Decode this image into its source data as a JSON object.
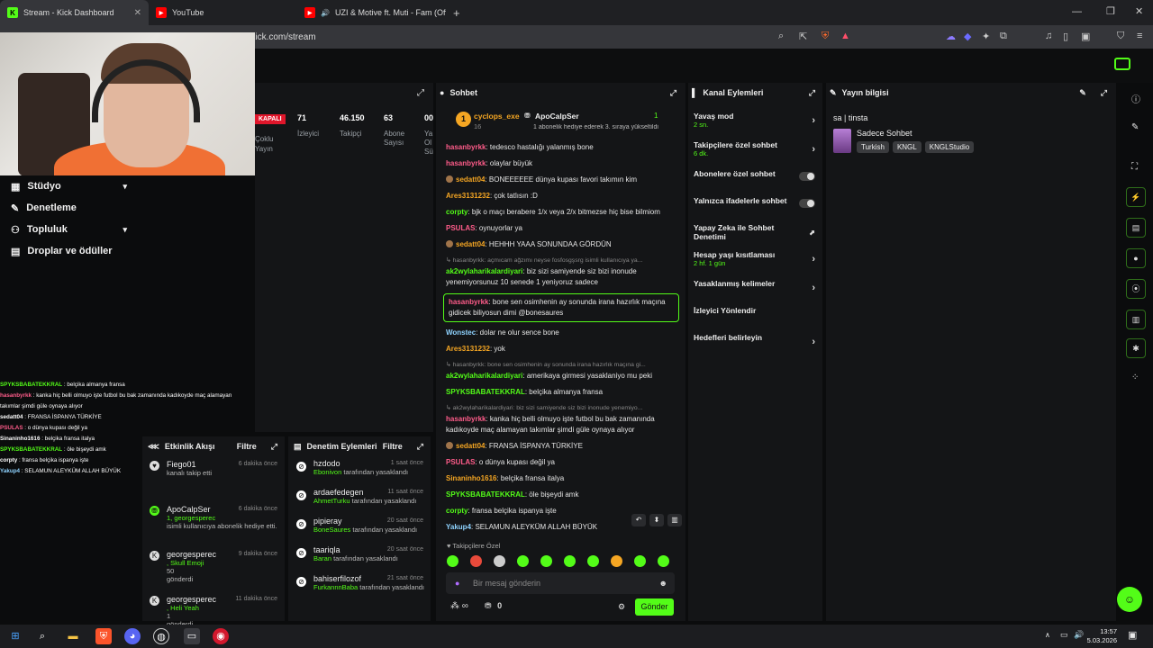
{
  "browser": {
    "tabs": [
      {
        "title": "Stream - Kick Dashboard",
        "active": true
      },
      {
        "title": "YouTube",
        "active": false
      },
      {
        "title": "UZI & Motive ft. Muti - Fam (Offi",
        "active": false
      }
    ],
    "new_tab": "+",
    "url": "board.kick.com/stream"
  },
  "sidenav": {
    "items": [
      {
        "label": "Stüdyo",
        "chev": true
      },
      {
        "label": "Denetleme",
        "chev": false
      },
      {
        "label": "Topluluk",
        "chev": true
      },
      {
        "label": "Droplar ve ödüller",
        "chev": false
      }
    ]
  },
  "overlay_chat": [
    {
      "user": "SPYKSBABATEKKRAL",
      "text": " : belçika almanya fransa",
      "color": "#53fc18"
    },
    {
      "user": "hasanbyrkk",
      "text": " : kanka hiç belli olmuyo işte futbol bu bak zamanında kadıkoyde maç alamayan",
      "color": "#ff5c8a"
    },
    {
      "user": "",
      "text": "takımlar şimdi güle oynaya alıyor",
      "color": "#fff"
    },
    {
      "user": "sedatt04",
      "text": " : FRANSA İSPANYA TÜRKİYE",
      "color": "#fff"
    },
    {
      "user": "PSULAS",
      "text": " : o dünya kupası değil ya",
      "color": "#ff5c8a"
    },
    {
      "user": "Sinaninho1616",
      "text": " : belçika fransa italya",
      "color": "#fff"
    },
    {
      "user": "SPYKSBABATEKKRAL",
      "text": " : öle bişeydi amk",
      "color": "#53fc18"
    },
    {
      "user": "corpty",
      "text": " : fransa belçika ispanya işte",
      "color": "#fff"
    },
    {
      "user": "Yakup4",
      "text": " : SELAMUN ALEYKÜM ALLAH BÜYÜK",
      "color": "#8fd3ff"
    }
  ],
  "stats": {
    "live": "KAPALI",
    "items": [
      {
        "value": "71",
        "label": "İzleyici"
      },
      {
        "value": "46.150",
        "label": "Takipçi"
      },
      {
        "value": "63",
        "label": "Abone Sayısı"
      },
      {
        "value": "00",
        "label": "Ya Ol Sü"
      }
    ],
    "left_label": "Çoklu Yayın"
  },
  "activity": {
    "title": "Etkinlik Akışı",
    "filter": "Filtre",
    "items": [
      {
        "name": "Fiego01",
        "time": "6 dakika önce",
        "line1": "kanalı takip etti",
        "line2": "",
        "line3": ""
      },
      {
        "name": "ApoCalpSer",
        "time": "6 dakika önce",
        "line1": "1, georgesperec",
        "line2": "isimli kullanıcıya abonelik hediye etti.",
        "line3": ""
      },
      {
        "name": "georgesperec",
        "time": "9 dakika önce",
        "line1": ", Skull Emoji",
        "line2": "50",
        "line3": "gönderdi"
      },
      {
        "name": "georgesperec",
        "time": "11 dakika önce",
        "line1": ", Heli Yeah",
        "line2": "1",
        "line3": "gönderdi"
      }
    ]
  },
  "moderation": {
    "title": "Denetim Eylemleri",
    "filter": "Filtre",
    "items": [
      {
        "name": "hzdodo",
        "time": "1 saat önce",
        "by": "Ebonivon",
        "action": " tarafından yasaklandı"
      },
      {
        "name": "ardaefedegen",
        "time": "11 saat önce",
        "by": "AhmetTurku",
        "action": " tarafından yasaklandı"
      },
      {
        "name": "pipieray",
        "time": "20 saat önce",
        "by": "BoneSaures",
        "action": " tarafından yasaklandı"
      },
      {
        "name": "taariqla",
        "time": "20 saat önce",
        "by": "Baran",
        "action": " tarafından yasaklandı"
      },
      {
        "name": "bahiserfilozof",
        "time": "21 saat önce",
        "by": "FurkannnBaba",
        "action": " tarafından yasaklandı"
      }
    ]
  },
  "chat": {
    "title": "Sohbet",
    "pinned_rank": "1",
    "pinned_user1": "cyclops_exe",
    "pinned_user1_count": "16",
    "pinned_user2": "ApoCalpSer",
    "pinned_count": "1",
    "pinned_text": "1 abonelik hediye ederek 3. sıraya yükseltildi",
    "messages": [
      {
        "user": "hasanbyrkk",
        "color": "#ff5c8a",
        "text": ": tedesco hastalığı yalanmış bone",
        "type": "normal",
        "badge": false
      },
      {
        "user": "hasanbyrkk",
        "color": "#ff5c8a",
        "text": ": olaylar büyük",
        "type": "normal",
        "badge": false
      },
      {
        "user": "sedatt04",
        "color": "#f5a623",
        "text": ": BONEEEEEE dünya kupası favori takımın kim",
        "type": "normal",
        "badge": true
      },
      {
        "user": "Ares3131232",
        "color": "#f5a623",
        "text": ": çok tatlısın :D",
        "type": "normal",
        "badge": false
      },
      {
        "user": "corpty",
        "color": "#53fc18",
        "text": ": bjk o maçı berabere 1/x veya 2/x bitmezse hiç bise bilmiom",
        "type": "normal",
        "badge": false
      },
      {
        "user": "PSULAS",
        "color": "#ff5c8a",
        "text": ": oynuyorlar ya",
        "type": "normal",
        "badge": false
      },
      {
        "user": "sedatt04",
        "color": "#f5a623",
        "text": ": HEHHH YAAA SONUNDAA GÖRDÜN",
        "type": "normal",
        "badge": true
      },
      {
        "user": "",
        "color": "#888",
        "text": "↳ hasanbyrkk: açmıcam ağzımı neyse fosfosgşsrg isimli kullanıcıya ya...",
        "type": "reply",
        "badge": false
      },
      {
        "user": "ak2wylaharikalardiyari",
        "color": "#53fc18",
        "text": ": biz sizi samiyende siz bizi inonude yenemiyorsunuz 10 senede 1 yeniyoruz sadece",
        "type": "normal",
        "badge": false
      },
      {
        "user": "hasanbyrkk",
        "color": "#ff5c8a",
        "text": ": bone sen osimhenin ay sonunda irana hazırlık maçına gidicek biliyosun dimi @bonesaures",
        "type": "highlight",
        "badge": false
      },
      {
        "user": "Wonstec",
        "color": "#8fd3ff",
        "text": ": dolar ne olur sence bone",
        "type": "normal",
        "badge": false
      },
      {
        "user": "Ares3131232",
        "color": "#f5a623",
        "text": ": yok",
        "type": "normal",
        "badge": false
      },
      {
        "user": "",
        "color": "#888",
        "text": "↳ hasanbyrkk: bone sen osimhenin ay sonunda irana hazırlık maçına gi...",
        "type": "reply",
        "badge": false
      },
      {
        "user": "ak2wylaharikalardiyari",
        "color": "#53fc18",
        "text": ": amerikaya girmesi yasaklaniyo mu peki",
        "type": "normal",
        "badge": false
      },
      {
        "user": "SPYKSBABATEKKRAL",
        "color": "#53fc18",
        "text": ": belçika almanya fransa",
        "type": "normal",
        "badge": false
      },
      {
        "user": "",
        "color": "#888",
        "text": "↳ ak2wylaharikalardiyari: biz sizi samiyende siz bizi inonude yenemiyo...",
        "type": "reply",
        "badge": false
      },
      {
        "user": "hasanbyrkk",
        "color": "#ff5c8a",
        "text": ": kanka hiç belli olmuyo işte futbol bu bak zamanında kadıkoyde maç alamayan takımlar şimdi güle oynaya alıyor",
        "type": "normal",
        "badge": false
      },
      {
        "user": "sedatt04",
        "color": "#f5a623",
        "text": ": FRANSA İSPANYA TÜRKİYE",
        "type": "normal",
        "badge": true
      },
      {
        "user": "PSULAS",
        "color": "#ff5c8a",
        "text": ": o dünya kupası değil ya",
        "type": "normal",
        "badge": false
      },
      {
        "user": "Sinaninho1616",
        "color": "#f5a623",
        "text": ": belçika fransa italya",
        "type": "normal",
        "badge": false
      },
      {
        "user": "SPYKSBABATEKKRAL",
        "color": "#53fc18",
        "text": ": öle bişeydi amk",
        "type": "normal",
        "badge": false
      },
      {
        "user": "corpty",
        "color": "#53fc18",
        "text": ": fransa belçika ispanya işte",
        "type": "normal",
        "badge": false
      },
      {
        "user": "Yakup4",
        "color": "#8fd3ff",
        "text": ": SELAMUN ALEYKÜM ALLAH BÜYÜK",
        "type": "normal",
        "badge": false
      }
    ],
    "subs_only_emotes": "Takipçilere Özel",
    "input_placeholder": "Bir mesaj gönderin",
    "points": "∞",
    "gift_count": "0",
    "send_label": "Gönder"
  },
  "channel_actions": {
    "title": "Kanal Eylemleri",
    "items": [
      {
        "label": "Yavaş mod",
        "sub": "2 sn.",
        "kind": "arrow"
      },
      {
        "label": "Takipçilere özel sohbet",
        "sub": "6 dk.",
        "kind": "arrow"
      },
      {
        "label": "Abonelere özel sohbet",
        "sub": "",
        "kind": "toggle"
      },
      {
        "label": "Yalnızca ifadelerle sohbet",
        "sub": "",
        "kind": "toggle"
      },
      {
        "label": "Yapay Zeka ile Sohbet Denetimi",
        "sub": "",
        "kind": "ext"
      },
      {
        "label": "Hesap yaşı kısıtlaması",
        "sub": "2 hf. 1 gün",
        "kind": "arrow"
      },
      {
        "label": "Yasaklanmış kelimeler",
        "sub": "",
        "kind": "arrow"
      },
      {
        "label": "İzleyici Yönlendir",
        "sub": "",
        "kind": "none"
      },
      {
        "label": "Hedefleri belirleyin",
        "sub": "",
        "kind": "arrow"
      }
    ]
  },
  "stream_info": {
    "title": "Yayın bilgisi",
    "stream_title": "sa | tinsta",
    "category": "Sadece Sohbet",
    "tags": [
      "Turkish",
      "KNGL",
      "KNGLStudio"
    ]
  },
  "taskbar": {
    "time": "13:57",
    "date": "5.03.2026"
  },
  "colors": {
    "accent": "#53fc18",
    "panel": "#141517",
    "background": "#0b0c0d"
  }
}
